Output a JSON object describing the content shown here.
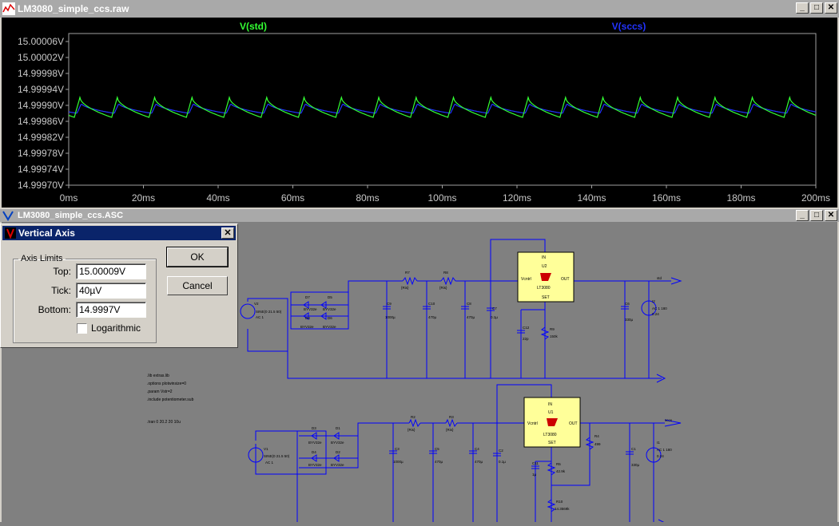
{
  "plot_window": {
    "title": "LM3080_simple_ccs.raw",
    "buttons": {
      "minimize": "_",
      "maximize": "□",
      "close": "✕"
    }
  },
  "schematic_window": {
    "title": "LM3080_simple_ccs.ASC",
    "buttons": {
      "minimize": "_",
      "maximize": "□",
      "close": "✕"
    }
  },
  "chart_data": {
    "type": "line",
    "series": [
      {
        "name": "V(std)",
        "color": "#33ff33"
      },
      {
        "name": "V(sccs)",
        "color": "#2233ff"
      }
    ],
    "y_tick_labels": [
      "15.00006V",
      "15.00002V",
      "14.99998V",
      "14.99994V",
      "14.99990V",
      "14.99986V",
      "14.99982V",
      "14.99978V",
      "14.99974V",
      "14.99970V"
    ],
    "x_tick_labels": [
      "0ms",
      "20ms",
      "40ms",
      "60ms",
      "80ms",
      "100ms",
      "120ms",
      "140ms",
      "160ms",
      "180ms",
      "200ms"
    ],
    "xlim": [
      0,
      200
    ],
    "ylim": [
      14.9997,
      15.00008
    ],
    "std_ripple": {
      "period_ms": 10,
      "min_V": 14.99987,
      "max_V": 14.99992
    },
    "sccs_ripple": {
      "period_ms": 10,
      "min_V": 14.99988,
      "max_V": 14.999905
    },
    "grid": false,
    "background": "#000000",
    "axis_text_color": "#c8c8c8"
  },
  "dialog": {
    "title": "Vertical Axis",
    "close": "✕",
    "group_label": "Axis Limits",
    "top_label": "Top:",
    "top_value": "15.00009V",
    "tick_label": "Tick:",
    "tick_value": "40µV",
    "bottom_label": "Bottom:",
    "bottom_value": "14.9997V",
    "logarithmic_label": "Logarithmic",
    "logarithmic_checked": false,
    "ok": "OK",
    "cancel": "Cancel"
  },
  "schematic": {
    "wire_color": "#0000ff",
    "directives": [
      ".lib extras.lib",
      ".options plotwinsize=0",
      ".param Vstr=2",
      ".include potentiometer.sub",
      ".tran 0 20.2 20 10u"
    ],
    "top": {
      "source": {
        "name": "V2",
        "value": "SINE(0 21.5 50)",
        "ac": "AC 1"
      },
      "diodes": [
        {
          "name": "D7",
          "model": "BYV32e"
        },
        {
          "name": "D5",
          "model": "BYV32e"
        },
        {
          "name": "D8",
          "model": "BYV32e"
        },
        {
          "name": "D6",
          "model": "BYV32e"
        }
      ],
      "resistors": [
        {
          "name": "R7",
          "value": "{Ris}"
        },
        {
          "name": "R8",
          "value": "{Ris}"
        }
      ],
      "caps": [
        {
          "name": "C9",
          "value": "1000µ"
        },
        {
          "name": "C10",
          "value": "470µ"
        },
        {
          "name": "C8",
          "value": "470µ"
        },
        {
          "name": "C7",
          "value": "0.1µ"
        },
        {
          "name": "C12",
          "value": "22p"
        },
        {
          "name": "C6",
          "value": "330µ"
        }
      ],
      "ic": {
        "name": "U2",
        "part": "LT3080",
        "pins": {
          "in": "IN",
          "vctrl": "Vcntrl",
          "out": "OUT",
          "set": "SET"
        }
      },
      "set_res": {
        "name": "R9",
        "value": "150k"
      },
      "load": {
        "name": "I2",
        "value": "AC 1 180",
        "dc": "0.24"
      },
      "net": "std"
    },
    "bottom": {
      "source": {
        "name": "V1",
        "value": "SINE(0 21.5 50)",
        "ac": "AC 1"
      },
      "diodes": [
        {
          "name": "D3",
          "model": "BYV32e"
        },
        {
          "name": "D1",
          "model": "BYV32e"
        },
        {
          "name": "D4",
          "model": "BYV32e"
        },
        {
          "name": "D2",
          "model": "BYV32e"
        }
      ],
      "resistors": [
        {
          "name": "R2",
          "value": "{Ris}"
        },
        {
          "name": "R3",
          "value": "{Ris}"
        }
      ],
      "caps": [
        {
          "name": "C3",
          "value": "1000µ"
        },
        {
          "name": "C5",
          "value": "470µ"
        },
        {
          "name": "C4",
          "value": "470µ"
        },
        {
          "name": "C2",
          "value": "0.1µ"
        },
        {
          "name": "C11",
          "value": "1µ"
        },
        {
          "name": "C1",
          "value": "330µ"
        }
      ],
      "ic": {
        "name": "U1",
        "part": "LT3080",
        "pins": {
          "in": "IN",
          "vctrl": "Vcntrl",
          "out": "OUT",
          "set": "SET"
        }
      },
      "r4": {
        "name": "R4",
        "value": "499"
      },
      "r5": {
        "name": "R5",
        "value": "42.9k"
      },
      "r10": {
        "name": "R10",
        "value": "14.3569k"
      },
      "load": {
        "name": "I1",
        "value": "AC 1 180",
        "dc": "0.24"
      },
      "net": "sccs"
    }
  }
}
